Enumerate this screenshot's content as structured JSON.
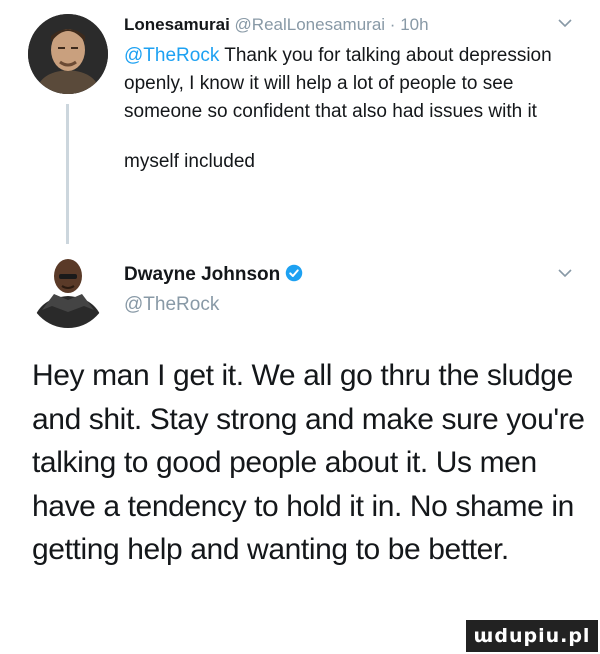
{
  "reply": {
    "author_name": "Lonesamurai",
    "author_handle": "@RealLonesamurai",
    "separator": "·",
    "time": "10h",
    "mention": "@TheRock",
    "text": " Thank you for talking about depression openly, I know it will help a lot of people to see someone so confident that also had issues with it",
    "text_extra": "myself included"
  },
  "main_tweet": {
    "author_name": "Dwayne Johnson",
    "author_handle": "@TheRock",
    "text": "Hey man I get it. We all go thru the sludge and shit. Stay strong and make sure you're talking to good people about it. Us men have a tendency to hold it in. No shame in getting help and wanting to be better."
  },
  "watermark": "ɯdupiu.pl",
  "colors": {
    "accent": "#1da1f2",
    "muted": "#8899a6",
    "text": "#14171a"
  },
  "icons": {
    "menu": "chevron-down-icon",
    "verified": "verified-badge-icon"
  }
}
